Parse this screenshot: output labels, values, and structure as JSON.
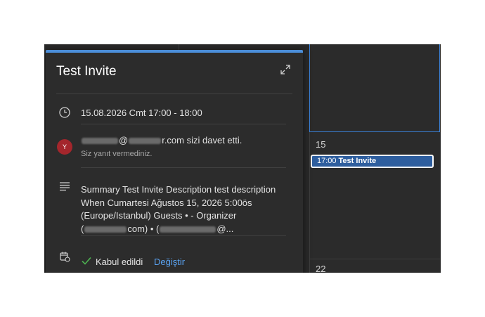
{
  "calendar": {
    "day_15": "15",
    "day_22": "22",
    "event": {
      "time": "17:00",
      "title": "Test Invite"
    }
  },
  "popup": {
    "title": "Test Invite",
    "datetime": "15.08.2026 Cmt 17:00 - 18:00",
    "organizer": {
      "avatar_initial": "Y",
      "at_sign": "@",
      "domain_suffix": "r.com",
      "invited_text": "sizi davet etti.",
      "response_status": "Siz yanıt vermediniz."
    },
    "description": {
      "line1": "Summary Test Invite Description test description",
      "line2": "When Cumartesi Ağustos 15, 2026 5:00ös",
      "line3": "(Europe/Istanbul) Guests • - Organizer",
      "line4_a": "(",
      "line4_b": "com) • (",
      "line4_c": "@..."
    },
    "rsvp": {
      "accepted_label": "Kabul edildi",
      "change_label": "Değiştir"
    }
  },
  "colors": {
    "accent": "#4b8ed9",
    "event_chip": "#2e5e9e",
    "avatar": "#a4262c",
    "link": "#5aa2f0",
    "check": "#4caf50"
  }
}
